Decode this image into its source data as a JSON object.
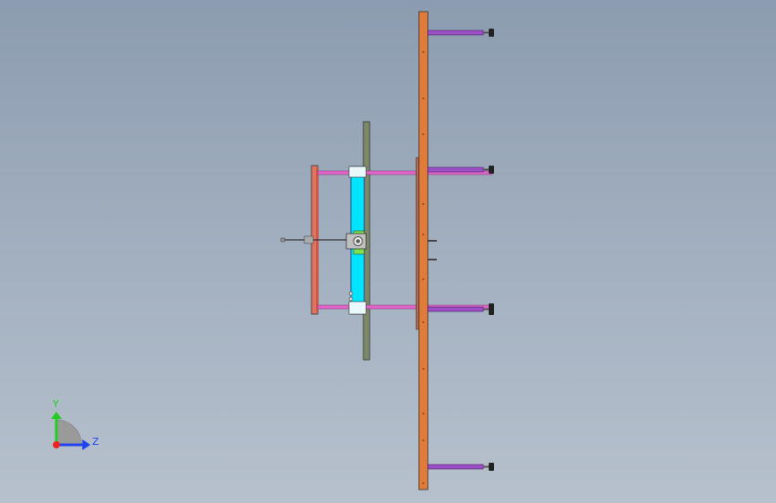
{
  "viewport": {
    "name": "cad-3d-viewport",
    "colors": {
      "background_top": "#8c9cb0",
      "background_bottom": "#b7c1cd",
      "main_beam": "#e07b39",
      "cylinder": "#9b4fc4",
      "rod": "#e066c8",
      "carriage": "#00e5ff",
      "back_plate": "#7d8a6a",
      "side_frame": "#e2735e",
      "motor": "#c0c0c0",
      "pad": "#222222"
    }
  },
  "triad": {
    "y_label": "Y",
    "z_label": "Z",
    "y_color": "#22cc22",
    "z_color": "#2244ee",
    "x_color": "#ee2222"
  }
}
